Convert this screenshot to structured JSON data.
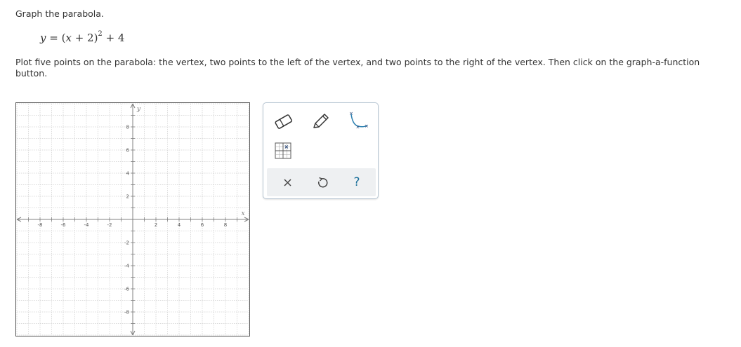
{
  "question": {
    "prompt": "Graph the parabola.",
    "equation": {
      "lhs": "y",
      "eq": " = ",
      "open": "(",
      "var": "x",
      "rest": " + 2)",
      "exp": "2",
      "tail": " + 4"
    },
    "instructions": "Plot five points on the parabola: the vertex, two points to the left of the vertex, and two points to the right of the vertex. Then click on the graph-a-function button."
  },
  "graph": {
    "xlim": [
      -10,
      10
    ],
    "ylim": [
      -10,
      10
    ],
    "x_tick_labels": [
      "-8",
      "-6",
      "-4",
      "-2",
      "2",
      "4",
      "6",
      "8"
    ],
    "y_tick_labels": [
      "8",
      "6",
      "4",
      "2",
      "-2",
      "-4",
      "-6",
      "-8"
    ],
    "x_axis_label": "x",
    "y_axis_label": "y",
    "grid": true
  },
  "toolbar": {
    "tools": [
      {
        "name": "eraser-tool",
        "icon": "eraser-icon"
      },
      {
        "name": "pencil-tool",
        "icon": "pencil-icon"
      },
      {
        "name": "graph-a-function-tool",
        "icon": "parabola-curve-icon"
      },
      {
        "name": "point-tool",
        "icon": "grid-point-icon"
      }
    ],
    "footer": {
      "clear_icon": "close-icon",
      "undo_icon": "undo-icon",
      "help_label": "?"
    }
  },
  "colors": {
    "text": "#333333",
    "grid": "#cfcfcf",
    "axis": "#808080",
    "toolbar_border": "#b8c6d3",
    "help": "#1a6f9a"
  }
}
